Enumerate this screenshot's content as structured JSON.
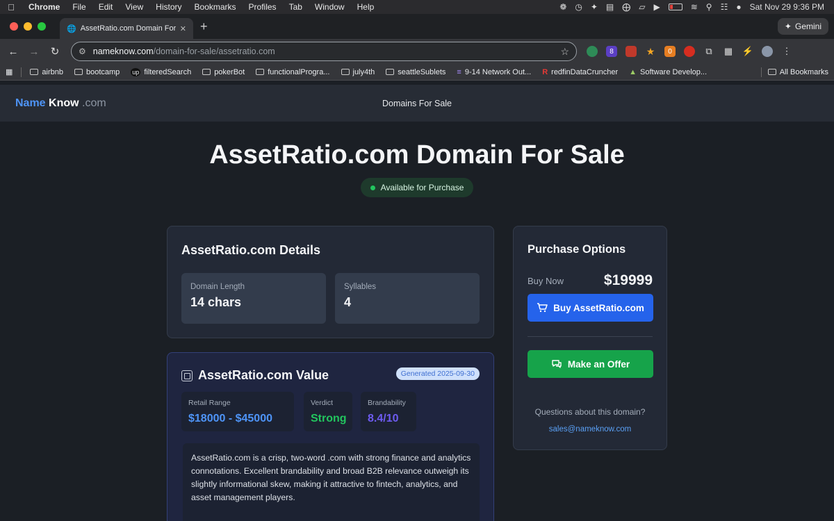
{
  "menubar": {
    "items": [
      "Chrome",
      "File",
      "Edit",
      "View",
      "History",
      "Bookmarks",
      "Profiles",
      "Tab",
      "Window",
      "Help"
    ],
    "datetime": "Sat Nov 29  9:36 PM"
  },
  "browser": {
    "tab_title": "AssetRatio.com Domain For S",
    "gemini_label": "Gemini",
    "url_host": "nameknow.com",
    "url_path": "/domain-for-sale/assetratio.com",
    "ext_badge_1": "8",
    "ext_badge_2": "0"
  },
  "bookmarks": {
    "items": [
      "airbnb",
      "bootcamp",
      "filteredSearch",
      "pokerBot",
      "functionalProgra...",
      "july4th",
      "seattleSublets",
      "9-14 Network Out...",
      "redfinDataCruncher",
      "Software Develop..."
    ],
    "all": "All Bookmarks"
  },
  "site": {
    "logo_a": "Name",
    "logo_b": "Know",
    "logo_c": ".com",
    "nav": "Domains For Sale"
  },
  "hero": {
    "title": "AssetRatio.com Domain For Sale",
    "status": "Available for Purchase"
  },
  "details": {
    "title": "AssetRatio.com Details",
    "length_label": "Domain Length",
    "length_value": "14 chars",
    "syllables_label": "Syllables",
    "syllables_value": "4"
  },
  "value": {
    "title": "AssetRatio.com Value",
    "generated": "Generated 2025-09-30",
    "retail_label": "Retail Range",
    "retail_value": "$18000 - $45000",
    "verdict_label": "Verdict",
    "verdict_value": "Strong",
    "brand_label": "Brandability",
    "brand_value": "8.4/10",
    "description": "AssetRatio.com is a crisp, two-word .com with strong finance and analytics connotations. Excellent brandability and broad B2B relevance outweigh its slightly informational skew, making it attractive to fintech, analytics, and asset management players."
  },
  "purchase": {
    "title": "Purchase Options",
    "buy_now_label": "Buy Now",
    "price": "$19999",
    "buy_button": "Buy AssetRatio.com",
    "offer_button": "Make an Offer",
    "question": "Questions about this domain?",
    "email": "sales@nameknow.com"
  },
  "colors": {
    "accent_blue": "#2563eb",
    "offer_green": "#16a34a",
    "retail_blue": "#4e94f7",
    "verdict_green": "#22c55e",
    "brand_purple": "#6d5bf0"
  }
}
